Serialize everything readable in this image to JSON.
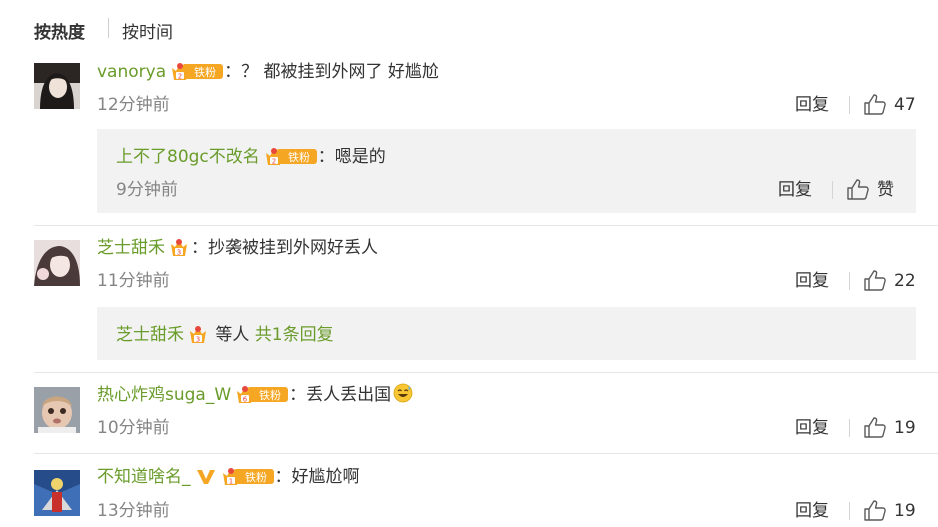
{
  "sort": {
    "hot_label": "按热度",
    "time_label": "按时间"
  },
  "comments": [
    {
      "user": "vanorya",
      "badge_level": "2",
      "badge_text": "铁粉",
      "text": "？ 都被挂到外网了 好尴尬",
      "time": "12分钟前",
      "reply_label": "回复",
      "likes": "47",
      "sub_reply": {
        "user": "上不了80gc不改名",
        "badge_level": "2",
        "badge_text": "铁粉",
        "text": "嗯是的",
        "time": "9分钟前",
        "reply_label": "回复",
        "like_label": "赞"
      }
    },
    {
      "user": "芝士甜禾",
      "badge_level": "3",
      "text": "抄袭被挂到外网好丢人",
      "time": "11分钟前",
      "reply_label": "回复",
      "likes": "22",
      "sub_summary": {
        "user": "芝士甜禾",
        "badge_level": "3",
        "middle": "等人",
        "more": "共1条回复"
      }
    },
    {
      "user": "热心炸鸡suga_W",
      "badge_level": "6",
      "badge_text": "铁粉",
      "text": "丢人丢出国",
      "time": "10分钟前",
      "reply_label": "回复",
      "likes": "19"
    },
    {
      "user": "不知道啥名_",
      "badge_level": "1",
      "badge_text": "铁粉",
      "text": "好尴尬啊",
      "time": "13分钟前",
      "reply_label": "回复",
      "likes": "19"
    }
  ],
  "colors": {
    "username": "#6a9c2b",
    "badge_orange": "#f5a623",
    "badge_red": "#e8473c",
    "subbox_bg": "#f2f2f2"
  }
}
